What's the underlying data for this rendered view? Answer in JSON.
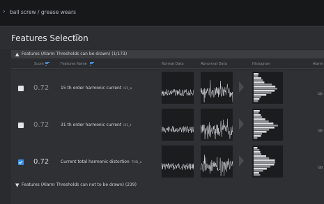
{
  "breadcrumb": {
    "text": "ball screw / grease wears"
  },
  "page": {
    "title": "Features Selection"
  },
  "groups": {
    "drawable": {
      "label": "Features (Alarm Thresholds can be drawn) (1/173)"
    },
    "not_drawable": {
      "label": "Features (Alarm Thresholds can not to be drawn) (239)"
    }
  },
  "columns": {
    "score": "Score",
    "feature_name": "Features Name",
    "normal": "Normal Data",
    "abnormal": "Abnormal Data",
    "histogram": "Histogram",
    "alarm": "Alarm"
  },
  "rows": [
    {
      "checked": false,
      "score": "0.72",
      "name": "15 th order harmonic current",
      "sub": "I15_a",
      "alarm": "Up"
    },
    {
      "checked": false,
      "score": "0.72",
      "name": "31 th order harmonic current",
      "sub": "I31_t",
      "alarm": "Up"
    },
    {
      "checked": true,
      "score": "0.72",
      "name": "Current total harmonic distortion",
      "sub": "THD_a",
      "alarm": "Up"
    }
  ],
  "icons": {
    "breadcrumb": "chevron-right-icon",
    "info": "info-icon",
    "sort": "sort-icon",
    "expanded": "triangle-up-icon",
    "collapsed": "triangle-down-icon",
    "next": "arrow-right-icon"
  },
  "colors": {
    "accent": "#3a8ee6",
    "sort_accent": "#4fa3ff",
    "background": "#2a2b2d"
  }
}
